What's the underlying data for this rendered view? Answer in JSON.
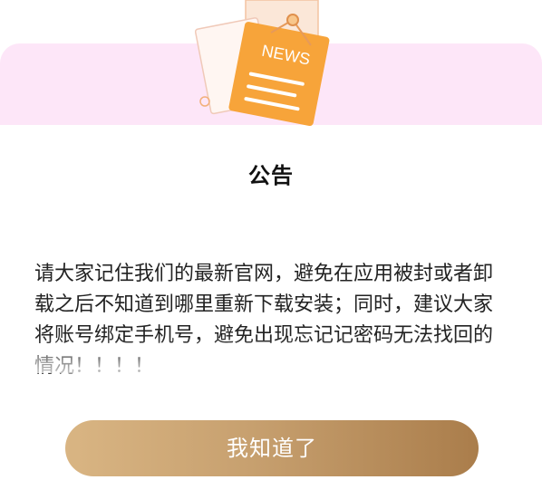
{
  "dialog": {
    "title": "公告",
    "message": "请大家记住我们的最新官网，避免在应用被封或者卸载之后不知道到哪里重新下载安装；同时，建议大家将账号绑定手机号，避免出现忘记记密码无法找回的情况！！！！",
    "confirm_label": "我知道了",
    "illustration_text": "NEWS"
  },
  "colors": {
    "header_band": "#fde6f8",
    "button_gradient_start": "#d9b583",
    "button_gradient_end": "#aa7d4b",
    "news_card": "#f7a43a"
  },
  "icons": {
    "header": "news-icon"
  }
}
